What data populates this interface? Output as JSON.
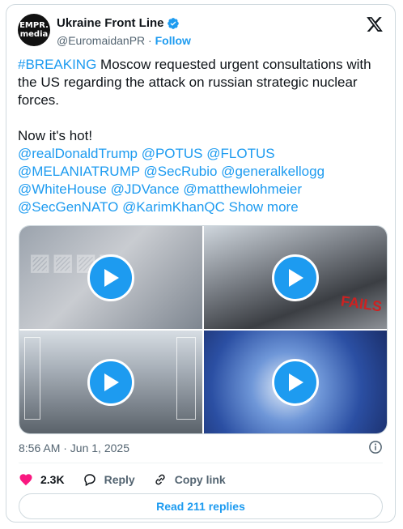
{
  "author": {
    "avatar_text_line1": "EMPR.",
    "avatar_text_line2": "media",
    "display_name": "Ukraine Front Line",
    "handle": "@EuromaidanPR",
    "separator": "·",
    "follow_label": "Follow"
  },
  "post": {
    "hashtag": "#BREAKING",
    "text_1": "Moscow requested urgent consultations with the US regarding the attack on russian strategic nuclear forces.",
    "text_2": "Now it's hot!",
    "mentions": [
      "@realDonaldTrump",
      "@POTUS",
      "@FLOTUS",
      "@MELANIATRUMP",
      "@SecRubio",
      "@generalkellogg",
      "@WhiteHouse",
      "@JDVance",
      "@matthewlohmeier",
      "@SecGenNATO",
      "@KarimKhanQC"
    ],
    "show_more": "Show more"
  },
  "media": {
    "tile2_overlay": "FAILS",
    "videos": [
      "video-1",
      "video-2",
      "video-3",
      "video-4"
    ]
  },
  "meta": {
    "timestamp": "8:56 AM · Jun 1, 2025"
  },
  "actions": {
    "likes": "2.3K",
    "reply_label": "Reply",
    "copy_link_label": "Copy link"
  },
  "read_replies_label": "Read 211 replies",
  "colors": {
    "accent": "#1d9bf0",
    "like": "#f91880",
    "muted": "#536471"
  },
  "icons": [
    "verified-badge-icon",
    "x-logo-icon",
    "play-icon",
    "info-icon",
    "heart-icon",
    "reply-icon",
    "link-icon"
  ]
}
